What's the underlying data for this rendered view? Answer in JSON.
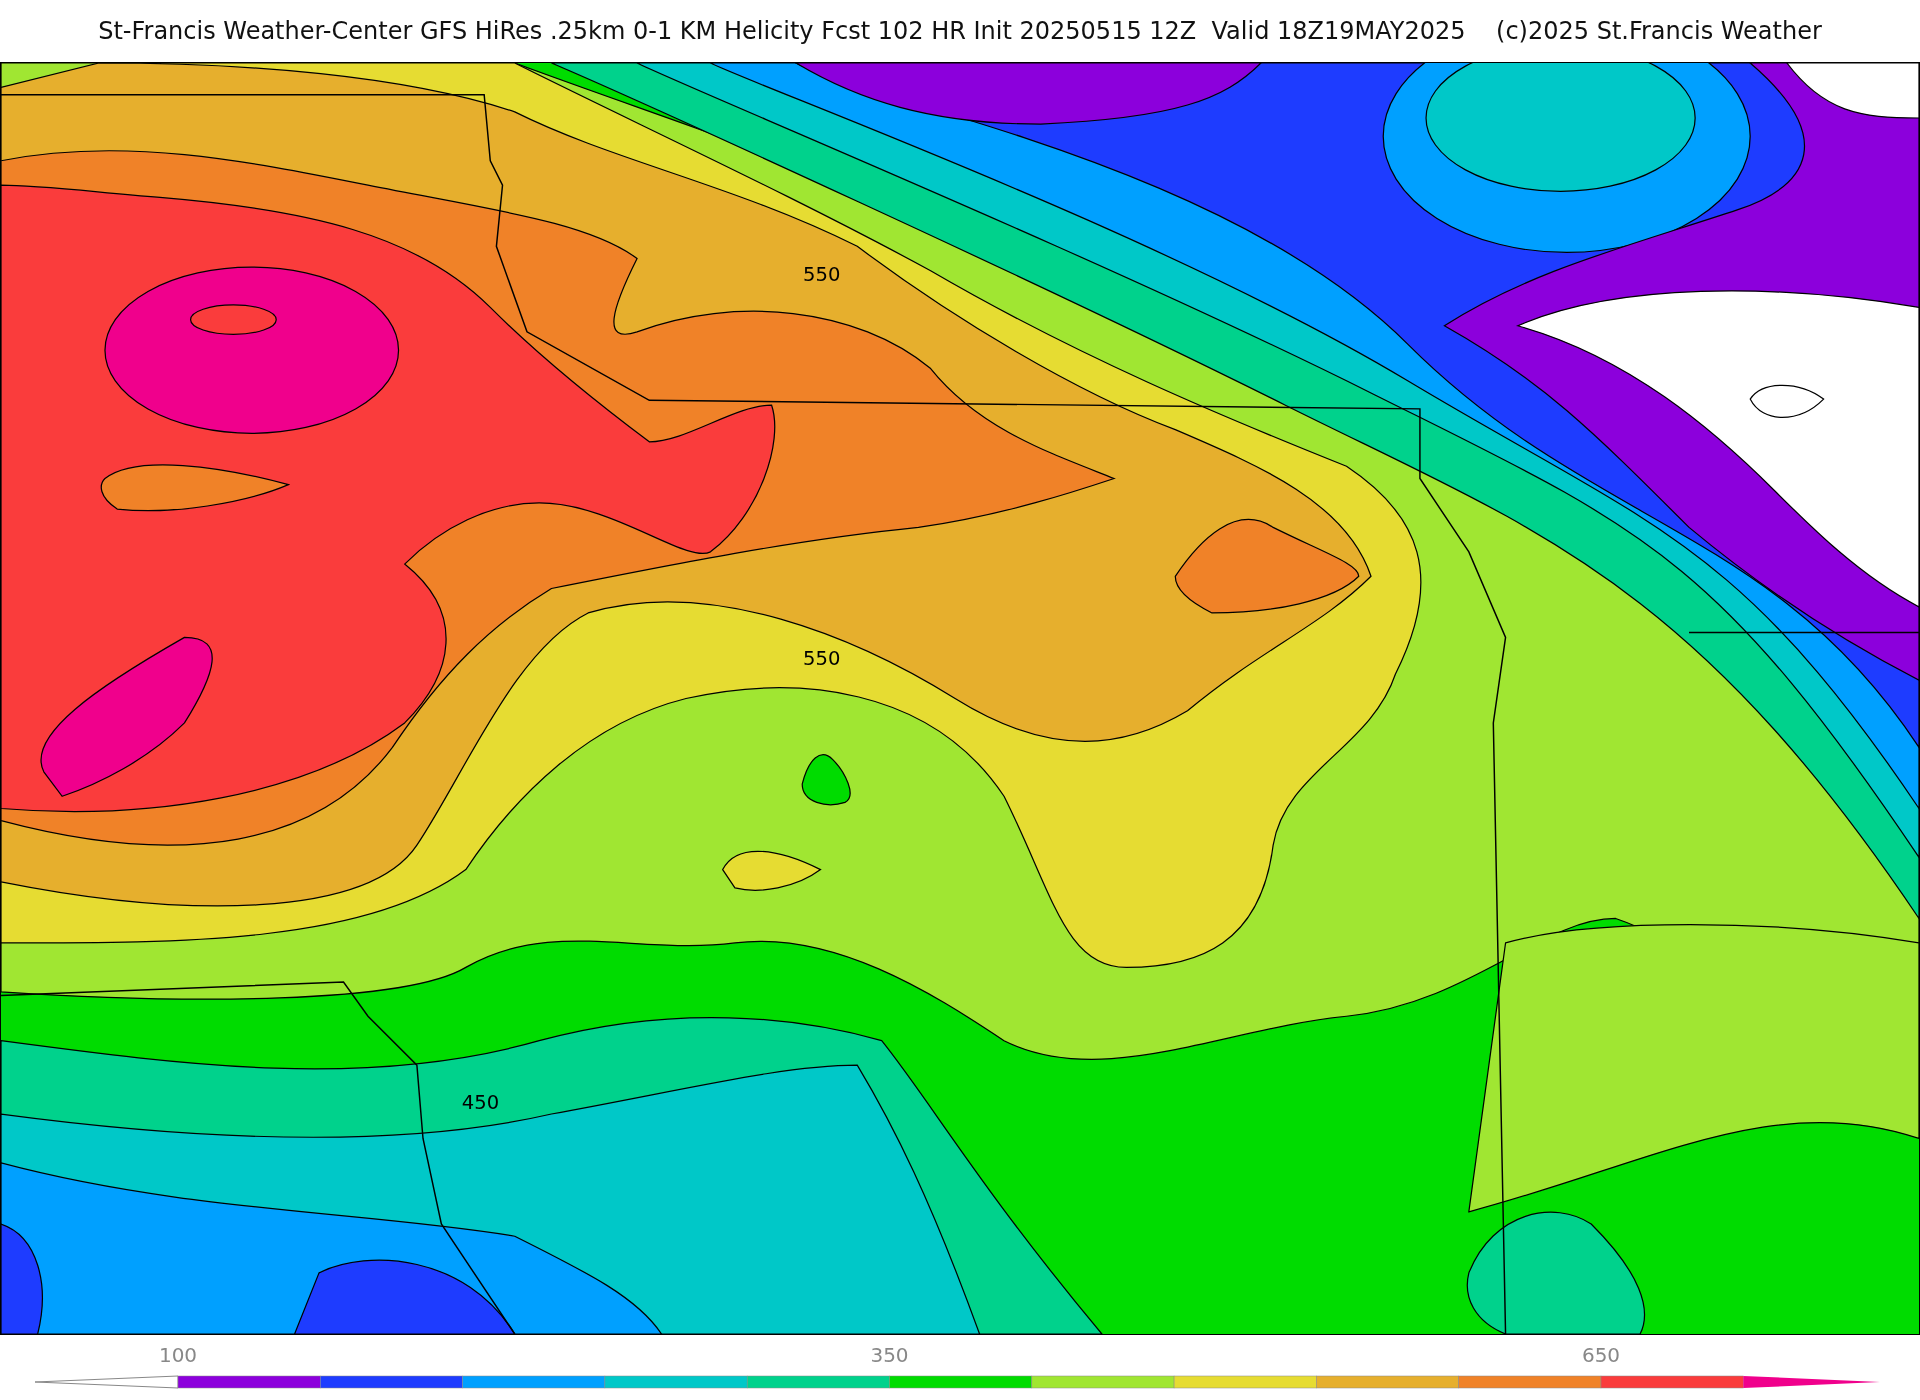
{
  "title": "St-Francis Weather-Center GFS HiRes .25km 0-1 KM Helicity Fcst 102 HR Init 20250515 12Z  Valid 18Z19MAY2025    (c)2025 St.Francis Weather",
  "map": {
    "contour_labels": [
      "550",
      "550",
      "450"
    ]
  },
  "colorbar": {
    "segments": [
      {
        "kind": "under-arrow",
        "color": "#ffffff"
      },
      {
        "color": "#8c00dc",
        "tick": "100"
      },
      {
        "color": "#1e3cff"
      },
      {
        "color": "#00a0ff"
      },
      {
        "color": "#00c8c8"
      },
      {
        "color": "#00d28c"
      },
      {
        "color": "#00dc00",
        "tick": "350"
      },
      {
        "color": "#a0e632"
      },
      {
        "color": "#e6dc32"
      },
      {
        "color": "#e6af2d"
      },
      {
        "color": "#f08228"
      },
      {
        "color": "#fa3c3c",
        "tick": "650"
      },
      {
        "kind": "over-arrow",
        "color": "#f0008c"
      }
    ]
  }
}
